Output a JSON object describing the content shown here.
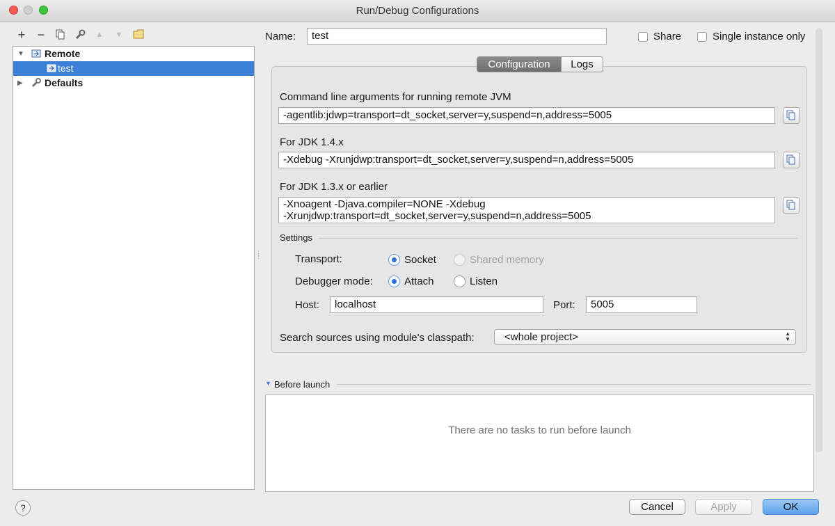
{
  "window": {
    "title": "Run/Debug Configurations"
  },
  "toolbar": {
    "add": "+",
    "remove": "−",
    "up": "▲",
    "down": "▼"
  },
  "tree": {
    "items": [
      {
        "label": "Remote"
      },
      {
        "label": "test"
      },
      {
        "label": "Defaults"
      }
    ]
  },
  "name_field": {
    "label": "Name:",
    "value": "test"
  },
  "share": {
    "label": "Share"
  },
  "single_instance": {
    "label": "Single instance only"
  },
  "tabs": [
    {
      "label": "Configuration"
    },
    {
      "label": "Logs"
    }
  ],
  "config": {
    "cmd_label": "Command line arguments for running remote JVM",
    "cmd_value": "-agentlib:jdwp=transport=dt_socket,server=y,suspend=n,address=5005",
    "jdk14_label": "For JDK 1.4.x",
    "jdk14_value": "-Xdebug -Xrunjdwp:transport=dt_socket,server=y,suspend=n,address=5005",
    "jdk13_label": "For JDK 1.3.x or earlier",
    "jdk13_line1": "-Xnoagent -Djava.compiler=NONE -Xdebug",
    "jdk13_line2": "-Xrunjdwp:transport=dt_socket,server=y,suspend=n,address=5005"
  },
  "settings": {
    "section_label": "Settings",
    "transport_label": "Transport:",
    "transport_socket": "Socket",
    "transport_shared": "Shared memory",
    "mode_label": "Debugger mode:",
    "mode_attach": "Attach",
    "mode_listen": "Listen",
    "host_label": "Host:",
    "host_value": "localhost",
    "port_label": "Port:",
    "port_value": "5005",
    "search_label": "Search sources using module's classpath:",
    "search_value": "<whole project>"
  },
  "before_launch": {
    "label": "Before launch",
    "empty": "There are no tasks to run before launch"
  },
  "buttons": {
    "help": "?",
    "cancel": "Cancel",
    "apply": "Apply",
    "ok": "OK"
  },
  "colors": {
    "selection": "#3c7fd7",
    "radio_on": "#2a6fd6",
    "ok_button": "#5ea3ec"
  }
}
